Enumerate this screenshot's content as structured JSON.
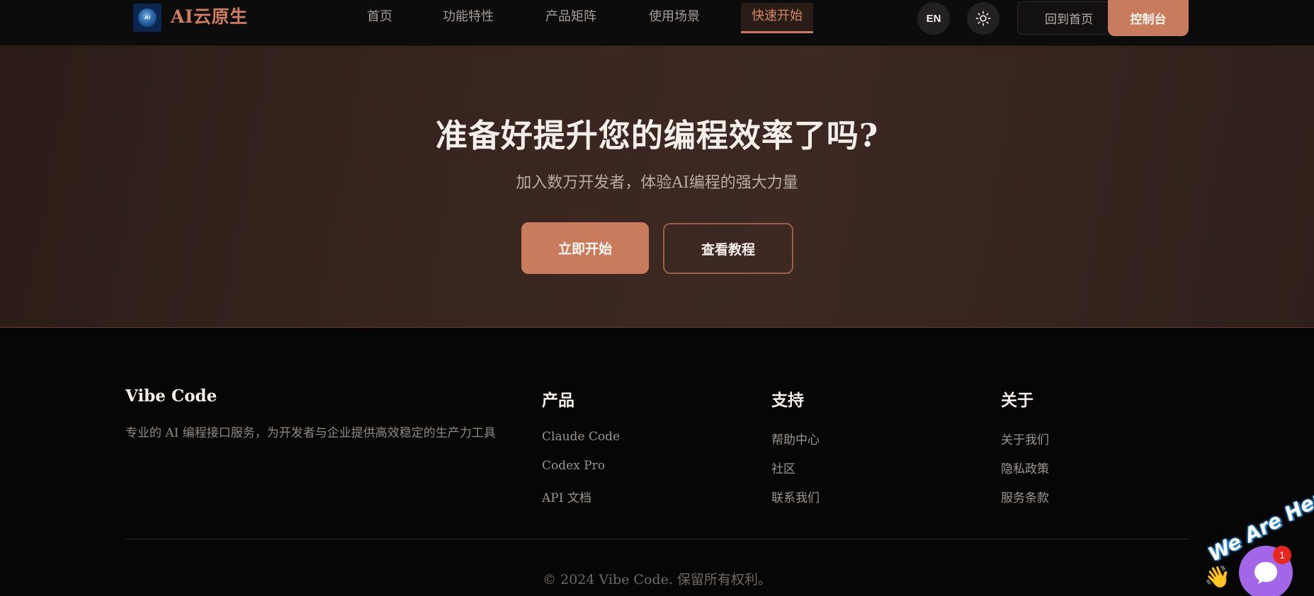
{
  "nav": {
    "brand": "AI云原生",
    "logo_text": "AI",
    "links": [
      "首页",
      "功能特性",
      "产品矩阵",
      "使用场景",
      "快速开始"
    ],
    "active_link": "快速开始",
    "lang_label": "EN",
    "theme_icon": "sun-icon",
    "home_label": "回到首页",
    "console_label": "控制台"
  },
  "cta": {
    "title": "准备好提升您的编程效率了吗?",
    "subtitle": "加入数万开发者，体验AI编程的强大力量",
    "primary_label": "立即开始",
    "secondary_label": "查看教程"
  },
  "footer": {
    "brand": "Vibe Code",
    "description": "专业的 AI 编程接口服务，为开发者与企业提供高效稳定的生产力工具",
    "columns": [
      {
        "title": "产品",
        "links": [
          "Claude Code",
          "Codex Pro",
          "API 文档"
        ]
      },
      {
        "title": "支持",
        "links": [
          "帮助中心",
          "社区",
          "联系我们"
        ]
      },
      {
        "title": "关于",
        "links": [
          "关于我们",
          "隐私政策",
          "服务条款"
        ]
      }
    ],
    "copyright": "© 2024 Vibe Code. 保留所有权利。"
  },
  "chat_widget": {
    "sticker_text": "We Are Here!",
    "badge_count": "1",
    "icon": "chat-bubble-icon"
  },
  "colors": {
    "accent": "#c97c5d",
    "brand_text": "#cf7d5f",
    "background": "#070606",
    "hero_bg": "#3a2620",
    "chat_bubble": "#a466e8",
    "badge": "#e8261f"
  }
}
